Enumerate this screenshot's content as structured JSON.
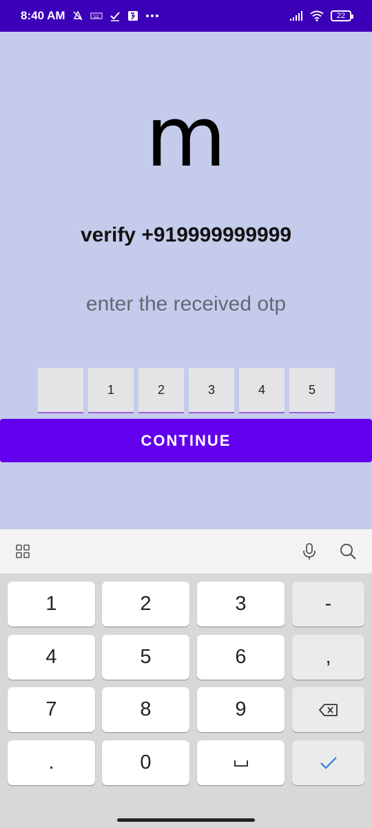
{
  "status_bar": {
    "time": "8:40 AM",
    "battery": "22",
    "icons": [
      "mute-icon",
      "keyboard-icon",
      "check-icon",
      "app-icon",
      "more-icon",
      "signal-icon",
      "wifi-icon",
      "battery-icon"
    ]
  },
  "app": {
    "logo": "m",
    "verify_title": "verify +919999999999",
    "instruction": "enter the received otp",
    "otp_digits": [
      "",
      "1",
      "2",
      "3",
      "4",
      "5"
    ],
    "continue_label": "CONTINUE",
    "colors": {
      "accent": "#6200ee",
      "status_bar": "#3c00b8",
      "background": "#c5cceb",
      "otp_underline": "#9a5fd2"
    }
  },
  "keyboard": {
    "toolbar_icons": [
      "grid-icon",
      "microphone-icon",
      "search-icon"
    ],
    "rows": [
      [
        "1",
        "2",
        "3",
        "-"
      ],
      [
        "4",
        "5",
        "6",
        ","
      ],
      [
        "7",
        "8",
        "9",
        "backspace"
      ],
      [
        ".",
        "0",
        "space",
        "done"
      ]
    ]
  }
}
